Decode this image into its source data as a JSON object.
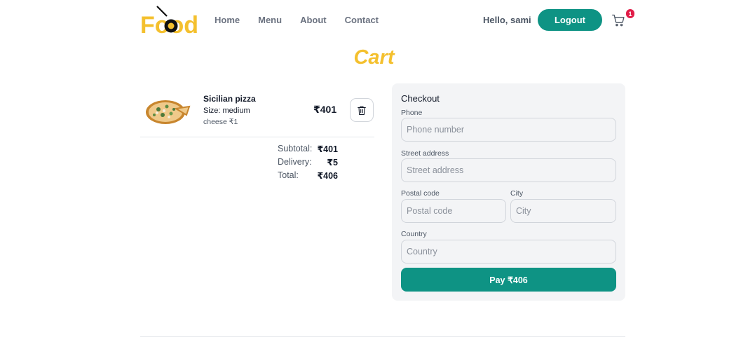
{
  "header": {
    "logo_text": "Food",
    "nav": [
      {
        "label": "Home"
      },
      {
        "label": "Menu"
      },
      {
        "label": "About"
      },
      {
        "label": "Contact"
      }
    ],
    "greeting": "Hello, sami",
    "logout_label": "Logout",
    "cart_count": "1",
    "cart_icon": "cart-icon"
  },
  "page": {
    "title": "Cart"
  },
  "cart": {
    "items": [
      {
        "name": "Sicilian pizza",
        "size": "Size: medium",
        "extras": "cheese ₹1",
        "price": "₹401",
        "delete_icon": "trash-icon"
      }
    ],
    "totals": {
      "subtotal_label": "Subtotal:",
      "subtotal_value": "₹401",
      "delivery_label": "Delivery:",
      "delivery_value": "₹5",
      "total_label": "Total:",
      "total_value": "₹406"
    }
  },
  "checkout": {
    "title": "Checkout",
    "phone": {
      "label": "Phone",
      "placeholder": "Phone number",
      "value": ""
    },
    "street": {
      "label": "Street address",
      "placeholder": "Street address",
      "value": ""
    },
    "postal": {
      "label": "Postal code",
      "placeholder": "Postal code",
      "value": ""
    },
    "city": {
      "label": "City",
      "placeholder": "City",
      "value": ""
    },
    "country": {
      "label": "Country",
      "placeholder": "Country",
      "value": ""
    },
    "pay_label": "Pay ₹406"
  },
  "colors": {
    "accent": "#0e9384",
    "brand": "#f4c02e",
    "badge": "#e11d48"
  }
}
